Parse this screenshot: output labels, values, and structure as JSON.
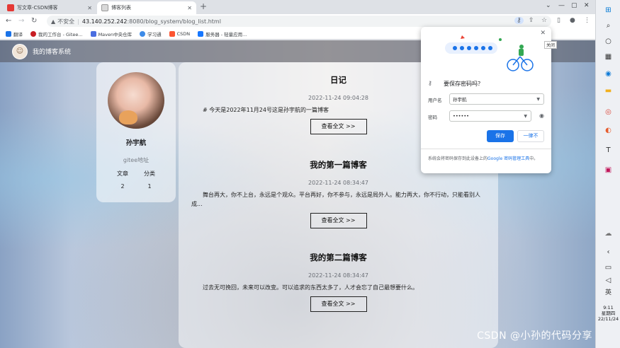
{
  "browser": {
    "tabs": [
      {
        "title": "写文章-CSDN博客",
        "active": false,
        "color": "#e53935"
      },
      {
        "title": "博客列表",
        "active": true,
        "color": "#f0f0f0"
      }
    ],
    "url_security": "不安全",
    "url_host": "43.140.252.242",
    "url_path": ":8080/blog_system/blog_list.html",
    "bookmarks": [
      {
        "label": "翻译",
        "color": "#1a73e8"
      },
      {
        "label": "我的工作台 - Gitee...",
        "color": "#c71d23"
      },
      {
        "label": "Maven中央仓库",
        "color": "#4a6ee0"
      },
      {
        "label": "学习通",
        "color": "#3d8be8"
      },
      {
        "label": "CSDN",
        "color": "#fc5531"
      },
      {
        "label": "服务器 - 轻量应用...",
        "color": "#1677ff"
      }
    ]
  },
  "site": {
    "title": "我的博客系统"
  },
  "profile": {
    "name": "孙宇航",
    "gitee_label": "gitee地址",
    "stats_labels": [
      "文章",
      "分类"
    ],
    "stats_values": [
      "2",
      "1"
    ]
  },
  "posts": [
    {
      "title": "日记",
      "date": "2022-11-24 09:04:28",
      "abstract": "# 今天是2022年11月24号这是孙宇航的一篇博客",
      "button": "查看全文 >>"
    },
    {
      "title": "我的第一篇博客",
      "date": "2022-11-24 08:34:47",
      "abstract": "舞台再大，你不上台，永远是个观众。平台再好，你不参与，永远是局外人。能力再大，你不行动，只能看别人成...",
      "button": "查看全文 >>"
    },
    {
      "title": "我的第二篇博客",
      "date": "2022-11-24 08:34:47",
      "abstract": "过去无可挽回，未来可以改变。可以追求的东西太多了，人才会忘了自己最想要什么。",
      "button": "查看全文 >>"
    }
  ],
  "password_dialog": {
    "title": "要保存密码吗？",
    "close_tip": "关闭",
    "username_label": "用户名",
    "username_value": "孙宇航",
    "password_label": "密码",
    "password_value": "••••••",
    "save_label": "保存",
    "never_label": "一律不",
    "footer_text": "系统会将密码保存到此设备上的",
    "footer_link": "Google 密码管理工具",
    "footer_end": "中。"
  },
  "watermark": "CSDN @小孙的代码分享",
  "taskbar": {
    "lang": "英",
    "time": "9:11",
    "weekday": "星期四",
    "date": "22/11/24"
  }
}
